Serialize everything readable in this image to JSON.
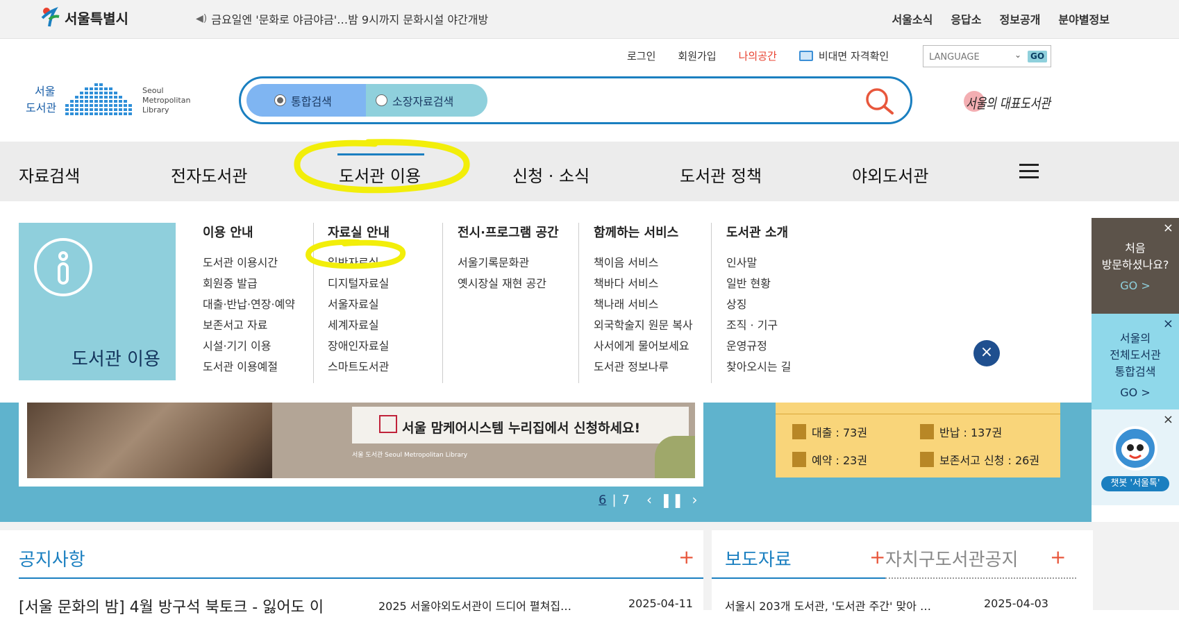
{
  "topbar": {
    "seoul_logo": "서울특별시",
    "notice": "금요일엔 '문화로 야금야금'…밤 9시까지 문화시설 야간개방",
    "links": [
      "서울소식",
      "응답소",
      "정보공개",
      "분야별정보"
    ]
  },
  "header": {
    "util_links": [
      "로그인",
      "회원가입",
      "나의공간",
      "비대면 자격확인"
    ],
    "language": {
      "label": "LANGUAGE",
      "go": "GO"
    },
    "library_logo": {
      "ko_line1": "서울",
      "ko_line2": "도서관",
      "en_line1": "Seoul",
      "en_line2": "Metropolitan",
      "en_line3": "Library"
    },
    "search_tabs": [
      {
        "label": "통합검색",
        "selected": true
      },
      {
        "label": "소장자료검색",
        "selected": false
      }
    ],
    "rep_logo": "서울의 대표도서관"
  },
  "gnb": {
    "items": [
      "자료검색",
      "전자도서관",
      "도서관 이용",
      "신청 · 소식",
      "도서관 정책",
      "야외도서관"
    ],
    "active_index": 2
  },
  "dropdown": {
    "title": "도서관 이용",
    "columns": [
      {
        "heading": "이용 안내",
        "items": [
          "도서관 이용시간",
          "회원증 발급",
          "대출·반납·연장·예약",
          "보존서고 자료",
          "시설·기기 이용",
          "도서관 이용예절"
        ]
      },
      {
        "heading": "자료실 안내",
        "items": [
          "일반자료실",
          "디지털자료실",
          "서울자료실",
          "세계자료실",
          "장애인자료실",
          "스마트도서관"
        ]
      },
      {
        "heading": "전시·프로그램 공간",
        "items": [
          "서울기록문화관",
          "옛시장실 재현 공간"
        ]
      },
      {
        "heading": "함께하는 서비스",
        "items": [
          "책이음 서비스",
          "책바다 서비스",
          "책나래 서비스",
          "외국학술지 원문 복사",
          "사서에게 물어보세요",
          "도서관 정보나루"
        ]
      },
      {
        "heading": "도서관 소개",
        "items": [
          "인사말",
          "일반 현황",
          "상징",
          "조직 · 기구",
          "운영규정",
          "찾아오시는 길"
        ]
      }
    ]
  },
  "banner": {
    "ad_text": "서울 맘케어시스템 누리집에서 신청하세요!",
    "ad_mini": "서울 도서관 Seoul Metropolitan Library",
    "current": "6",
    "total": "7",
    "separator": "|"
  },
  "loan": {
    "borrow": "대출 : 73권",
    "return": "반납 : 137권",
    "reserve": "예약 : 23권",
    "archive": "보존서고 신청 : 26권"
  },
  "notice": {
    "title": "공지사항",
    "plus": "+",
    "featured": "[서울 문화의 밤] 4월 방구석 북토크 - 잃어도 이",
    "item_title": "2025 서울야외도서관이 드디어 펼쳐집…",
    "item_date": "2025-04-11"
  },
  "press": {
    "title": "보도자료",
    "title2": "자치구도서관공지",
    "plus": "+",
    "item_title": "서울시 203개 도서관, '도서관 주간' 맞아 …",
    "item_date": "2025-04-03"
  },
  "quick": {
    "first_visit": [
      "처음",
      "방문하셨나요?"
    ],
    "go": "GO  >",
    "integrated": [
      "서울의",
      "전체도서관",
      "통합검색"
    ],
    "chatbot": "챗봇 '서울톡'",
    "close": "×"
  },
  "colors": {
    "brand_blue": "#1a7fc0",
    "accent_red": "#e8412f",
    "highlighter": "#f2ee0a",
    "menu_box": "#8fcfdc"
  }
}
